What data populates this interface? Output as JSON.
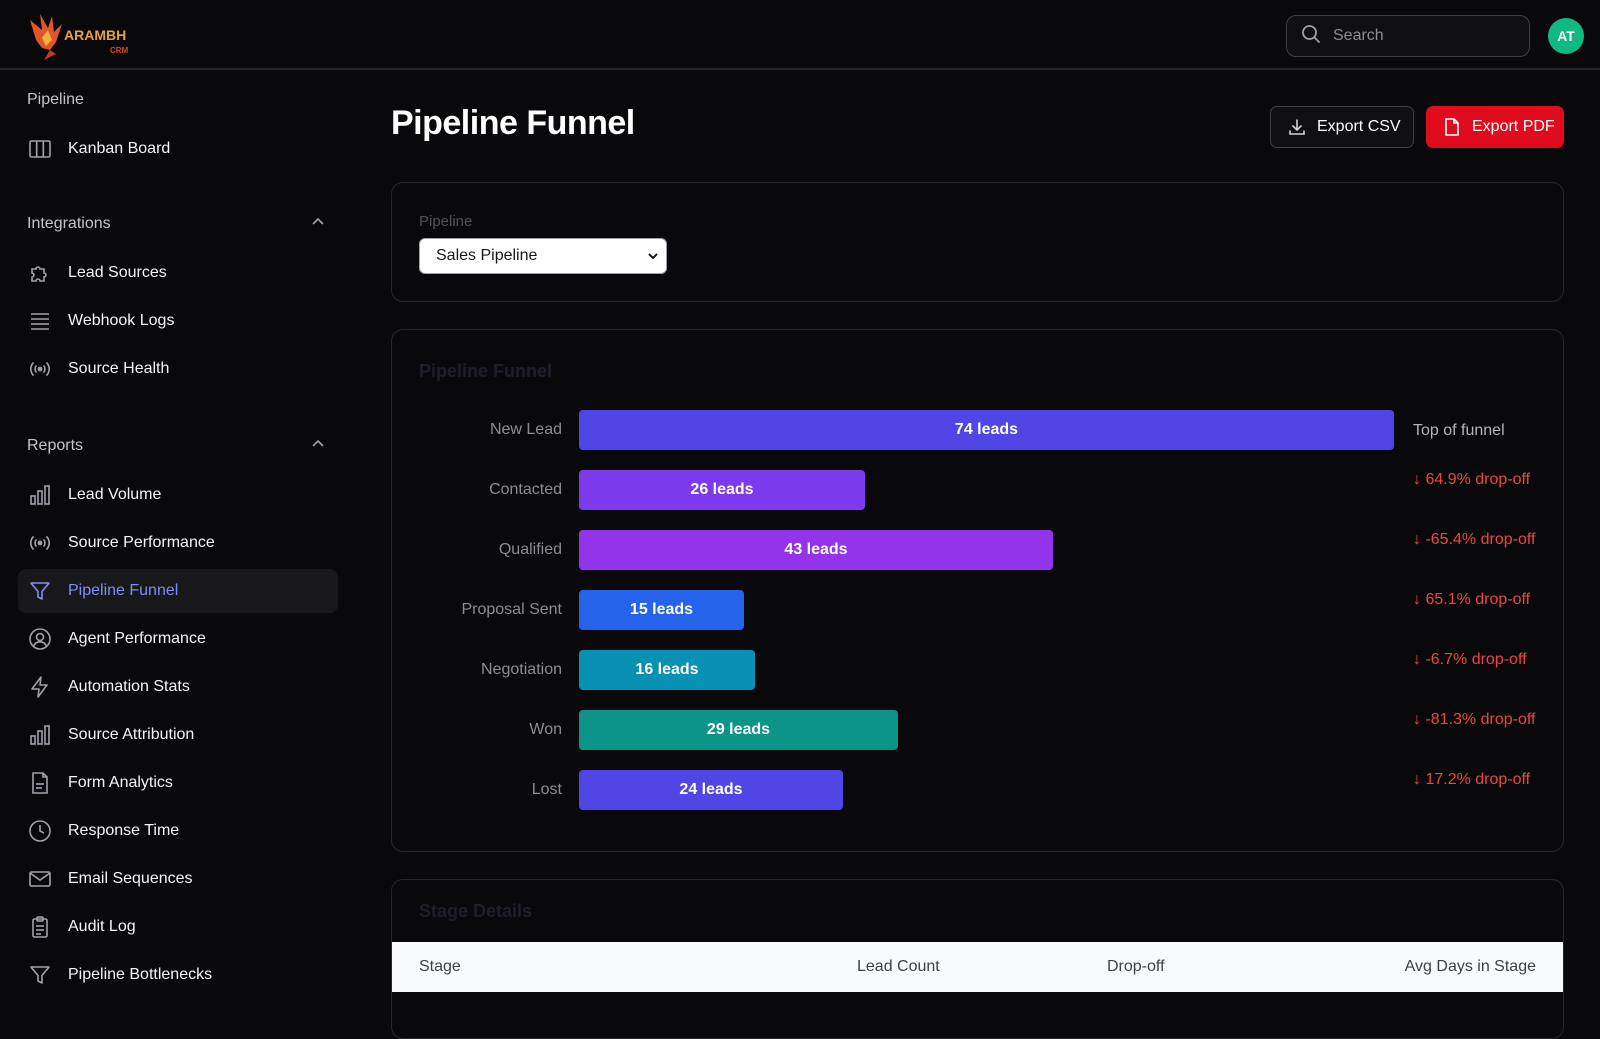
{
  "brand": {
    "name": "ARAMBH",
    "sub": "CRM"
  },
  "search": {
    "placeholder": "Search"
  },
  "user": {
    "initials": "AT"
  },
  "sidebar": {
    "pipeline_title": "Pipeline",
    "pipeline_items": [
      {
        "label": "Kanban Board",
        "icon": "kanban-icon"
      }
    ],
    "integrations_title": "Integrations",
    "integrations_items": [
      {
        "label": "Lead Sources",
        "icon": "puzzle-icon"
      },
      {
        "label": "Webhook Logs",
        "icon": "list-icon"
      },
      {
        "label": "Source Health",
        "icon": "radio-signal-icon"
      }
    ],
    "reports_title": "Reports",
    "reports_items": [
      {
        "label": "Lead Volume",
        "icon": "bar-chart-icon"
      },
      {
        "label": "Source Performance",
        "icon": "radio-signal-icon"
      },
      {
        "label": "Pipeline Funnel",
        "icon": "funnel-icon",
        "active": true
      },
      {
        "label": "Agent Performance",
        "icon": "user-circle-icon"
      },
      {
        "label": "Automation Stats",
        "icon": "lightning-icon"
      },
      {
        "label": "Source Attribution",
        "icon": "bar-chart-icon"
      },
      {
        "label": "Form Analytics",
        "icon": "document-icon"
      },
      {
        "label": "Response Time",
        "icon": "clock-icon"
      },
      {
        "label": "Email Sequences",
        "icon": "mail-icon"
      },
      {
        "label": "Audit Log",
        "icon": "clipboard-icon"
      },
      {
        "label": "Pipeline Bottlenecks",
        "icon": "funnel-icon"
      }
    ]
  },
  "main": {
    "title": "Pipeline Funnel",
    "export_csv": "Export CSV",
    "export_pdf": "Export PDF",
    "filter_label": "Pipeline",
    "filter_value": "Sales Pipeline",
    "funnel_title": "Pipeline Funnel",
    "details_title": "Stage Details",
    "table_headers": [
      "Stage",
      "Lead Count",
      "Drop-off",
      "Avg Days in Stage"
    ]
  },
  "colors": {
    "accent": "#818cf8",
    "danger": "#ef4444",
    "export_pdf": "#e00b1c",
    "avatar": "#10b981"
  },
  "chart_data": {
    "type": "bar",
    "categories": [
      "New Lead",
      "Contacted",
      "Qualified",
      "Proposal Sent",
      "Negotiation",
      "Won",
      "Lost"
    ],
    "values": [
      74,
      26,
      43,
      15,
      16,
      29,
      24
    ],
    "bar_labels": [
      "74 leads",
      "26 leads",
      "43 leads",
      "15 leads",
      "16 leads",
      "29 leads",
      "24 leads"
    ],
    "annotations": [
      "Top of funnel",
      "↓ 64.9% drop-off",
      "↓ -65.4% drop-off",
      "↓ 65.1% drop-off",
      "↓ -6.7% drop-off",
      "↓ -81.3% drop-off",
      "↓ 17.2% drop-off"
    ],
    "colors": [
      "#4f46e5",
      "#7c3aed",
      "#9333ea",
      "#2563eb",
      "#0891b2",
      "#0d9488",
      "#4f46e5"
    ],
    "title": "Pipeline Funnel"
  }
}
